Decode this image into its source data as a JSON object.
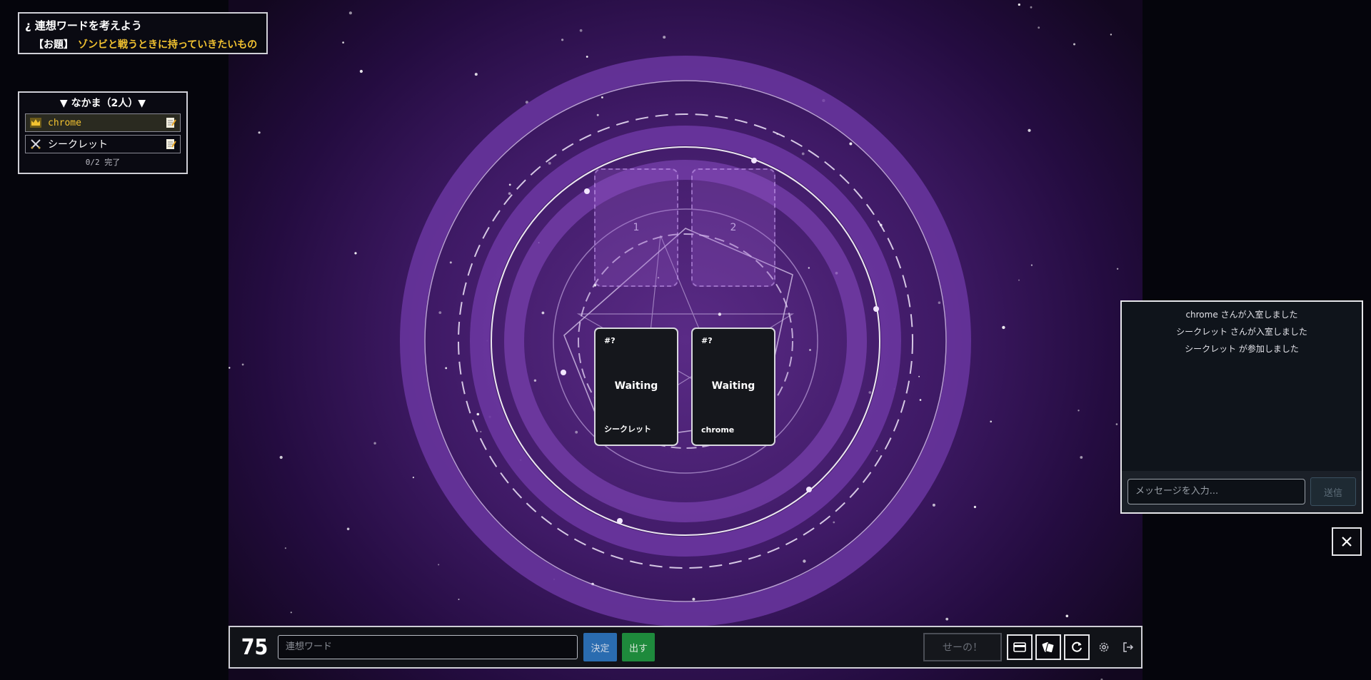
{
  "topic": {
    "title": "¿ 連想ワードを考えよう",
    "prefix": "【お題】",
    "text": "ゾンビと戦うときに持っていきたいもの"
  },
  "members": {
    "header": "▼ なかま（2人）▼",
    "list": [
      {
        "name": "chrome",
        "icon": "crown-icon",
        "host": true
      },
      {
        "name": "シークレット",
        "icon": "crossed-swords-icon",
        "host": false
      }
    ],
    "footer": "0/2 完了"
  },
  "slots": [
    {
      "label": "1"
    },
    {
      "label": "2"
    }
  ],
  "cards": [
    {
      "tag": "#?",
      "status": "Waiting",
      "owner": "シークレット"
    },
    {
      "tag": "#?",
      "status": "Waiting",
      "owner": "chrome"
    }
  ],
  "chat": {
    "messages": [
      "chrome さんが入室しました",
      "シークレット さんが入室しました",
      "シークレット が参加しました"
    ],
    "input_placeholder": "メッセージを入力...",
    "send_label": "送信"
  },
  "bottom_bar": {
    "timer": "75",
    "word_placeholder": "連想ワード",
    "decide_label": "決定",
    "submit_label": "出す",
    "seeno_label": "せーの！",
    "icons": [
      "card-icon",
      "cards-stack-icon",
      "refresh-icon",
      "gear-icon",
      "exit-icon"
    ]
  },
  "colors": {
    "accent_yellow": "#f2c230",
    "background_purple": "#3f1a66",
    "decide_blue": "#2a6cb0",
    "submit_green": "#1e8a3c"
  }
}
